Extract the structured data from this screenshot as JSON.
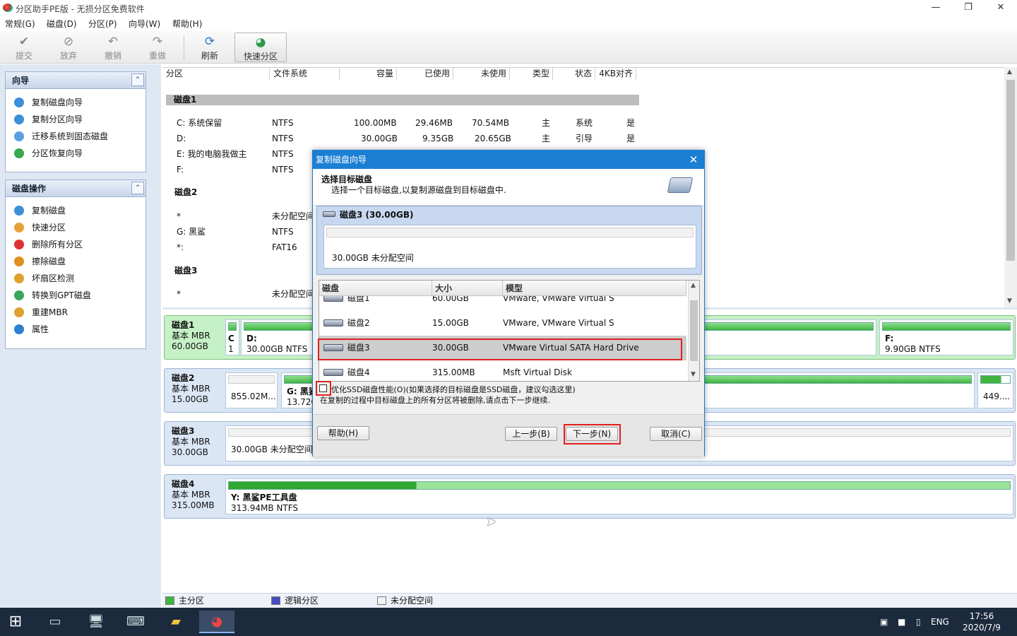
{
  "window": {
    "title": "分区助手PE版 - 无损分区免费软件"
  },
  "menu": [
    "常规(G)",
    "磁盘(D)",
    "分区(P)",
    "向导(W)",
    "帮助(H)"
  ],
  "toolbar": {
    "submit": "提交",
    "discard": "放弃",
    "undo": "撤销",
    "redo": "重做",
    "refresh": "刷新",
    "quick": "快速分区"
  },
  "wizard_panel": {
    "title": "向导",
    "items": [
      "复制磁盘向导",
      "复制分区向导",
      "迁移系统到固态磁盘",
      "分区恢复向导"
    ]
  },
  "disk_ops_panel": {
    "title": "磁盘操作",
    "items": [
      "复制磁盘",
      "快速分区",
      "删除所有分区",
      "擦除磁盘",
      "坏扇区检测",
      "转换到GPT磁盘",
      "重建MBR",
      "属性"
    ]
  },
  "grid": {
    "headers": [
      "分区",
      "文件系统",
      "容量",
      "已使用",
      "未使用",
      "类型",
      "状态",
      "4KB对齐"
    ],
    "disk1": {
      "label": "磁盘1",
      "rows": [
        [
          "C: 系统保留",
          "NTFS",
          "100.00MB",
          "29.46MB",
          "70.54MB",
          "主",
          "系统",
          "是"
        ],
        [
          "D:",
          "NTFS",
          "30.00GB",
          "9.35GB",
          "20.65GB",
          "主",
          "引导",
          "是"
        ],
        [
          "E: 我的电脑我做主",
          "NTFS"
        ],
        [
          "F:",
          "NTFS"
        ]
      ]
    },
    "disk2": {
      "label": "磁盘2",
      "rows": [
        [
          "*",
          "未分配空间"
        ],
        [
          "G: 黑鲨",
          "NTFS"
        ],
        [
          "*:",
          "FAT16"
        ]
      ]
    },
    "disk3": {
      "label": "磁盘3",
      "rows": [
        [
          "*",
          "未分配空间"
        ]
      ]
    }
  },
  "diskmap": {
    "d1": {
      "name": "磁盘1",
      "type": "基本 MBR",
      "size": "60.00GB",
      "c_label": "C",
      "c_size": "1",
      "d_label": "D:",
      "d_text": "30.00GB NTFS",
      "f_label": "F:",
      "f_text": "9.90GB NTFS"
    },
    "d2": {
      "name": "磁盘2",
      "type": "基本 MBR",
      "size": "15.00GB",
      "p1": "855.02M...",
      "p2_label": "G: 黑鲨",
      "p2_text": "13.72G",
      "p3": "449...."
    },
    "d3": {
      "name": "磁盘3",
      "type": "基本 MBR",
      "size": "30.00GB",
      "p1": "30.00GB 未分配空间"
    },
    "d4": {
      "name": "磁盘4",
      "type": "基本 MBR",
      "size": "315.00MB",
      "p1_label": "Y: 黑鲨PE工具盘",
      "p1_text": "313.94MB NTFS"
    }
  },
  "legend": {
    "primary": "主分区",
    "logical": "逻辑分区",
    "unalloc": "未分配空间",
    "primary_color": "#3fb53f",
    "logical_color": "#4a4ac0"
  },
  "dialog": {
    "title": "复制磁盘向导",
    "heading": "选择目标磁盘",
    "subheading": "选择一个目标磁盘,以复制源磁盘到目标磁盘中.",
    "selected_disk": "磁盘3 (30.00GB)",
    "selected_space": "30.00GB 未分配空间",
    "list_headers": [
      "磁盘",
      "大小",
      "模型"
    ],
    "disks": [
      {
        "name": "磁盘1",
        "size": "60.00GB",
        "model": "VMware, VMware Virtual S"
      },
      {
        "name": "磁盘2",
        "size": "15.00GB",
        "model": "VMware, VMware Virtual S"
      },
      {
        "name": "磁盘3",
        "size": "30.00GB",
        "model": "VMware Virtual SATA Hard Drive"
      },
      {
        "name": "磁盘4",
        "size": "315.00MB",
        "model": "Msft    Virtual Disk"
      }
    ],
    "ssd_option": "优化SSD磁盘性能(O)(如果选择的目标磁盘是SSD磁盘，建议勾选这里)",
    "warning": "在复制的过程中目标磁盘上的所有分区将被删除,请点击下一步继续.",
    "help": "帮助(H)",
    "prev": "上一步(B)",
    "next": "下一步(N)",
    "cancel": "取消(C)"
  },
  "taskbar": {
    "lang": "ENG",
    "time": "17:56",
    "date": "2020/7/9"
  }
}
